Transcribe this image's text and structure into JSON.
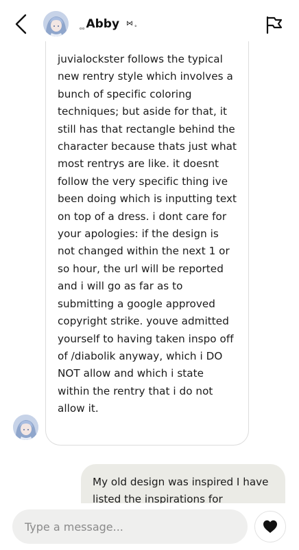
{
  "header": {
    "name": "Abby",
    "name_prefix_deco": "ₒₒ",
    "name_suffix_bow": "⋈",
    "name_suffix_ring": "°"
  },
  "messages": [
    {
      "direction": "incoming",
      "text": "juvialockster follows the typical new rentry style which involves a bunch of specific coloring techniques; but aside for that, it still has that rectangle behind the character because thats just what most rentrys are like. it doesnt follow the very specific thing ive been doing which is inputting text on top of a dress. i dont care for your apologies: if the design is not changed within the next 1 or so hour, the url will be reported and i will go as far as to submitting a google approved copyright strike. youve admitted yourself to having taken inspo off of /diabolik anyway, which i DO NOT allow and which i state within the rentry that i do not allow it."
    },
    {
      "direction": "outgoing",
      "text": "My old design was inspired I have listed the inspirations for"
    }
  ],
  "composer": {
    "placeholder": "Type a message..."
  },
  "icons": {
    "back": "chevron-left-icon",
    "report": "flag-icon",
    "like": "heart-icon"
  },
  "colors": {
    "outgoing_bubble": "#ebebe6",
    "input_bg": "#efefee",
    "incoming_border": "#dcdcdc"
  }
}
